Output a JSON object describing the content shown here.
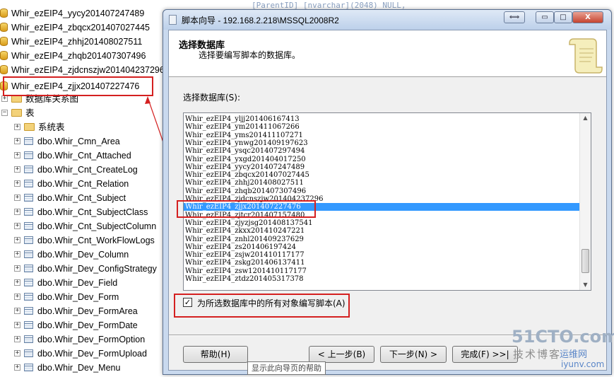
{
  "tree": {
    "databases": [
      "Whir_ezEIP4_yycy201407247489",
      "Whir_ezEIP4_zbqcx201407027445",
      "Whir_ezEIP4_zhhj201408027511",
      "Whir_ezEIP4_zhqb201407307496",
      "Whir_ezEIP4_zjdcnszjw201404237296",
      "Whir_ezEIP4_zjjx201407227476"
    ],
    "db_diagrams": "数据库关系图",
    "tables_folder": "表",
    "system_tables": "系统表",
    "tables": [
      "dbo.Whir_Cmn_Area",
      "dbo.Whir_Cnt_Attached",
      "dbo.Whir_Cnt_CreateLog",
      "dbo.Whir_Cnt_Relation",
      "dbo.Whir_Cnt_Subject",
      "dbo.Whir_Cnt_SubjectClass",
      "dbo.Whir_Cnt_SubjectColumn",
      "dbo.Whir_Cnt_WorkFlowLogs",
      "dbo.Whir_Dev_Column",
      "dbo.Whir_Dev_ConfigStrategy",
      "dbo.Whir_Dev_Field",
      "dbo.Whir_Dev_Form",
      "dbo.Whir_Dev_FormArea",
      "dbo.Whir_Dev_FormDate",
      "dbo.Whir_Dev_FormOption",
      "dbo.Whir_Dev_FormUpload",
      "dbo.Whir_Dev_Menu"
    ]
  },
  "bg_code": {
    "line1": "[ParentID] [nvarchar](2048) NULL,"
  },
  "wizard": {
    "title": "脚本向导 - 192.168.2.218\\MSSQL2008R2",
    "caption_buttons": {
      "restore": "⟺",
      "minimize": "▭",
      "maximize": "□",
      "close": "X"
    },
    "header_title": "选择数据库",
    "header_subtitle": "选择要编写脚本的数据库。",
    "list_label": "选择数据库(S):",
    "list_items": [
      "Whir_ezEIP4_yljj201406167413",
      "Whir_ezEIP4_ym201411067266",
      "Whir_ezEIP4_yms201411107271",
      "Whir_ezEIP4_ynwg201409197623",
      "Whir_ezEIP4_ysqc201407297494",
      "Whir_ezEIP4_yxgd201404017250",
      "Whir_ezEIP4_yycy201407247489",
      "Whir_ezEIP4_zbqcx201407027445",
      "Whir_ezEIP4_zhhj201408027511",
      "Whir_ezEIP4_zhqb201407307496",
      "Whir_ezEIP4_zjdcnszjw201404237296",
      "Whir_ezEIP4_zjjx201407227476",
      "Whir_ezEIP4_zjtcr201407157480",
      "Whir_ezEIP4_zjyzjsg201408137541",
      "Whir_ezEIP4_zkxx201410247221",
      "Whir_ezEIP4_znhl201409237629",
      "Whir_ezEIP4_zs201406197424",
      "Whir_ezEIP4_zsjw201410117177",
      "Whir_ezEIP4_zskg201406137411",
      "Whir_ezEIP4_zsw1201410117177",
      "Whir_ezEIP4_ztdz201405317378"
    ],
    "selected_index": 11,
    "checkbox_label": "为所选数据库中的所有对象编写脚本(A)",
    "checkbox_checked": "✓",
    "buttons": {
      "help": "帮助(H)",
      "back": "< 上一步(B)",
      "next": "下一步(N) >",
      "finish": "完成(F) >>|"
    },
    "tooltip": "显示此向导页的帮助"
  },
  "watermark": {
    "line1": "51CTO.com",
    "line2": "技术博客",
    "line3": "运维网",
    "line4": "iyunv.com"
  },
  "colors": {
    "highlight": "#3399ff",
    "annotation": "#d42020"
  }
}
